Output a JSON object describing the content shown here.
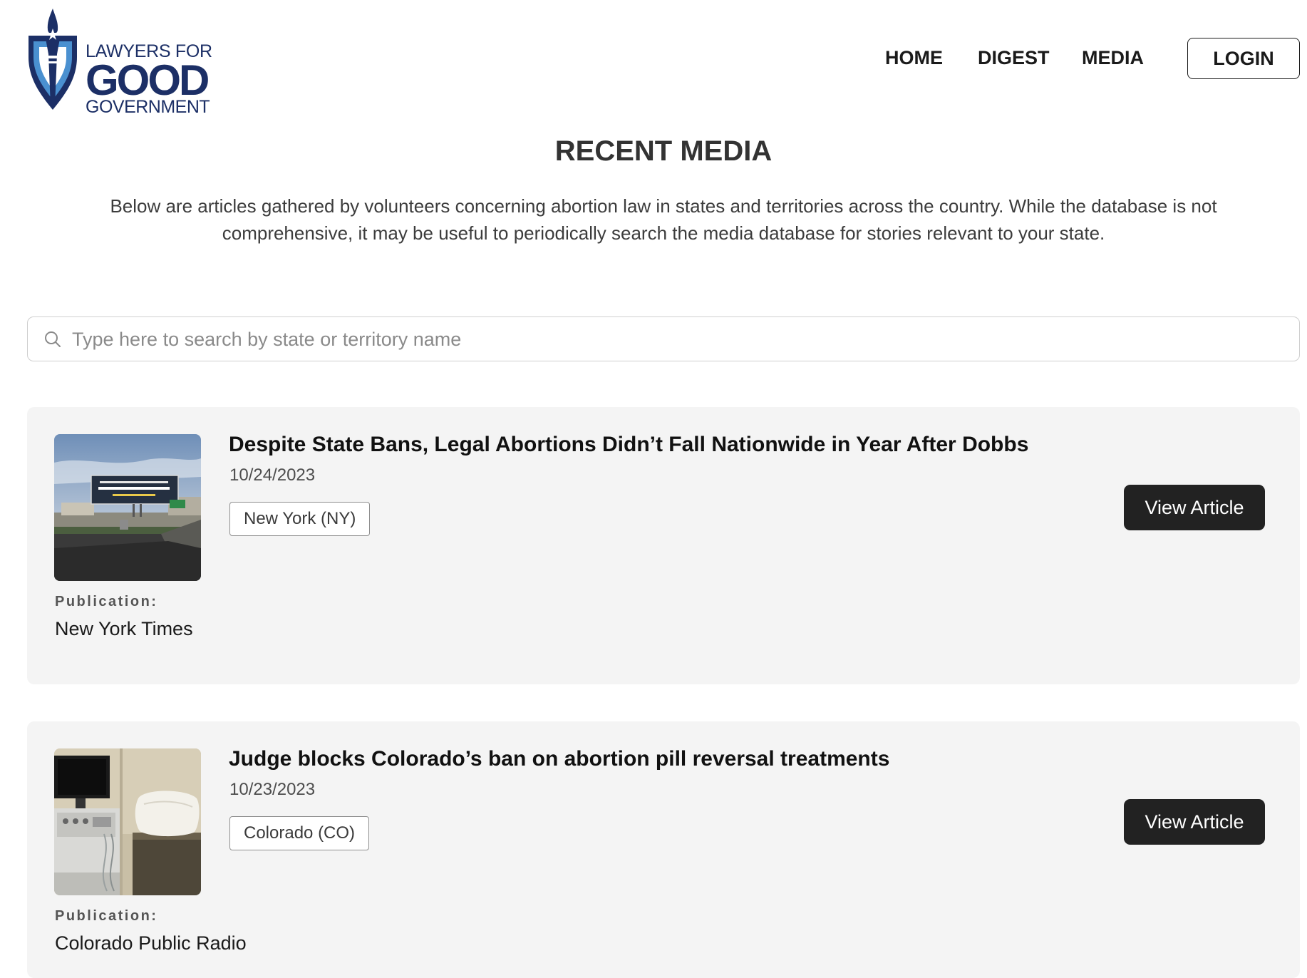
{
  "header": {
    "logo": {
      "line1": "LAWYERS FOR",
      "line2": "GOOD",
      "line3": "GOVERNMENT"
    },
    "nav": {
      "home": "HOME",
      "digest": "DIGEST",
      "media": "MEDIA",
      "login": "LOGIN"
    }
  },
  "main": {
    "title": "RECENT MEDIA",
    "intro_line1": "Below are articles gathered by volunteers concerning abortion law in states and territories across the country. While the database is not",
    "intro_line2": "comprehensive, it may be useful to periodically search the media database for stories relevant to your state.",
    "search": {
      "placeholder": "Type here to search by state or territory name",
      "value": ""
    }
  },
  "articles": [
    {
      "title": "Despite State Bans, Legal Abortions Didn’t Fall Nationwide in Year After Dobbs",
      "date": "10/24/2023",
      "state": "New York (NY)",
      "publication_label": "Publication:",
      "publication": "New York Times",
      "button": "View Article",
      "image": "billboard-photo"
    },
    {
      "title": "Judge blocks Colorado’s ban on abortion pill reversal treatments",
      "date": "10/23/2023",
      "state": "Colorado (CO)",
      "publication_label": "Publication:",
      "publication": "Colorado Public Radio",
      "button": "View Article",
      "image": "clinic-room-photo"
    }
  ],
  "colors": {
    "brand_navy": "#1c2f66",
    "brand_light_blue": "#4a90d0",
    "card_bg": "#f4f4f4",
    "button_bg": "#222222"
  }
}
